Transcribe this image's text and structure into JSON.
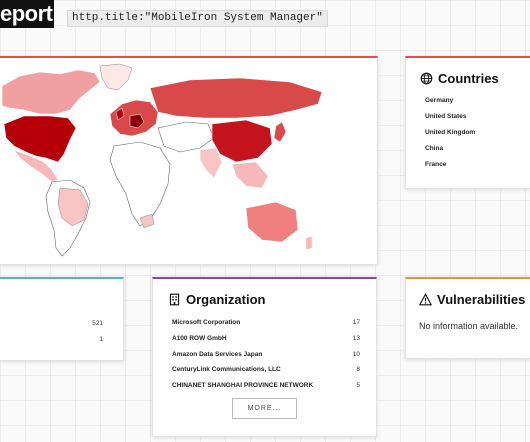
{
  "brand": {
    "text": "eport"
  },
  "search": {
    "query": "http.title:\"MobileIron System Manager\""
  },
  "map": {
    "fill_light": "#fde0e0",
    "fill_mid": "#f0a0a0",
    "fill_strong": "#d84a4a",
    "fill_top": "#b5000a"
  },
  "countries": {
    "title": "Countries",
    "icon": "globe-icon",
    "items": [
      "Germany",
      "United States",
      "United Kingdom",
      "China",
      "France"
    ]
  },
  "left_panel": {
    "values": [
      "521",
      "1"
    ]
  },
  "organization": {
    "title": "Organization",
    "icon": "building-icon",
    "rows": [
      {
        "name": "Microsoft Corporation",
        "count": "17"
      },
      {
        "name": "A100 ROW GmbH",
        "count": "13"
      },
      {
        "name": "Amazon Data Services Japan",
        "count": "10"
      },
      {
        "name": "CenturyLink Communications, LLC",
        "count": "8"
      },
      {
        "name": "CHINANET SHANGHAI PROVINCE NETWORK",
        "count": "5"
      }
    ],
    "more_label": "MORE..."
  },
  "vulnerabilities": {
    "title": "Vulnerabilities",
    "icon": "warning-icon",
    "message": "No information available."
  },
  "colors": {
    "map_accent": "#d9534f",
    "org_accent": "#8e44ad",
    "vuln_accent": "#e8942f",
    "left_accent": "#4fb3c9"
  }
}
